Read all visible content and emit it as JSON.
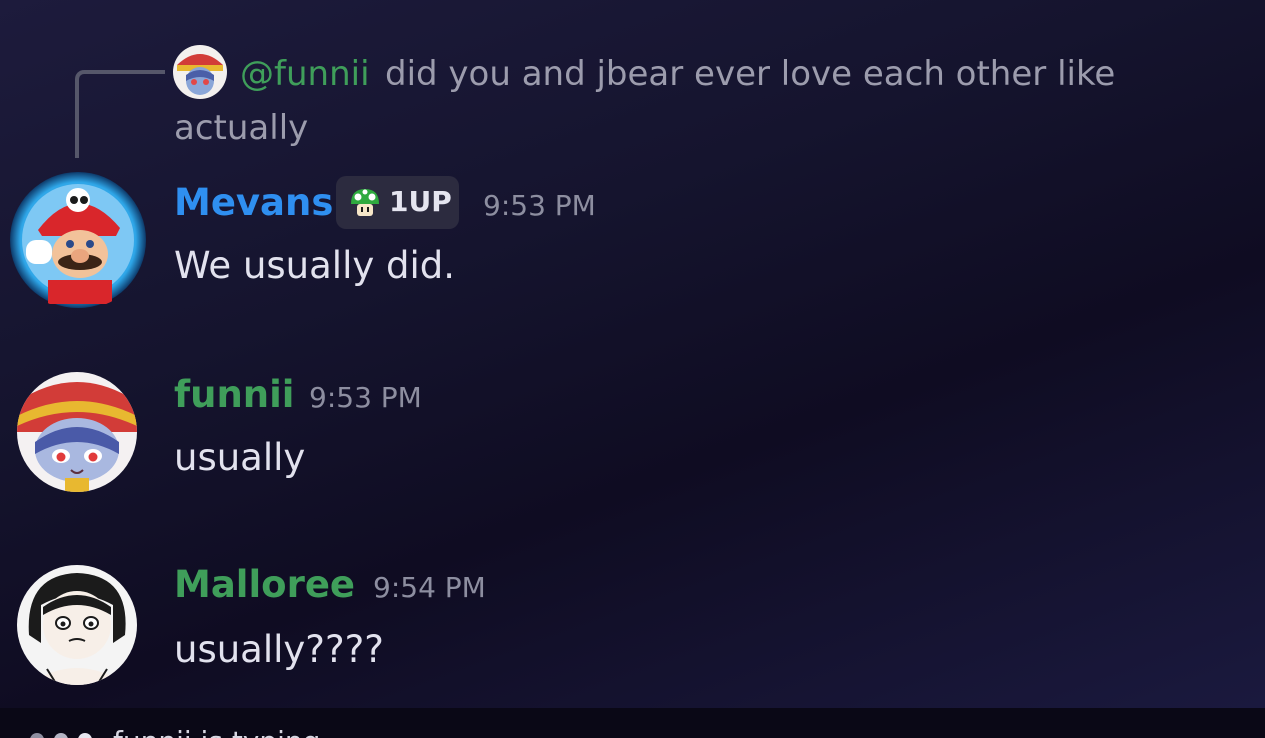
{
  "reply": {
    "mention": "@funnii",
    "text_line1": "did you and jbear ever love each other like",
    "text_line2": "actually"
  },
  "messages": [
    {
      "username": "Mevans",
      "username_color": "#2f8ff0",
      "badge": {
        "icon": "green-mushroom-icon",
        "label": "1UP"
      },
      "timestamp": "9:53 PM",
      "text": "We usually did."
    },
    {
      "username": "funnii",
      "username_color": "#3f9e5a",
      "timestamp": "9:53 PM",
      "text": "usually"
    },
    {
      "username": "Malloree",
      "username_color": "#3f9e5a",
      "timestamp": "9:54 PM",
      "text": "usually????"
    }
  ],
  "typing": {
    "text": "funnii is typing"
  },
  "colors": {
    "mention": "#3f9e5a",
    "reply_text": "#9c9cad",
    "timestamp": "#8d8ea0",
    "background": "#15142e"
  }
}
